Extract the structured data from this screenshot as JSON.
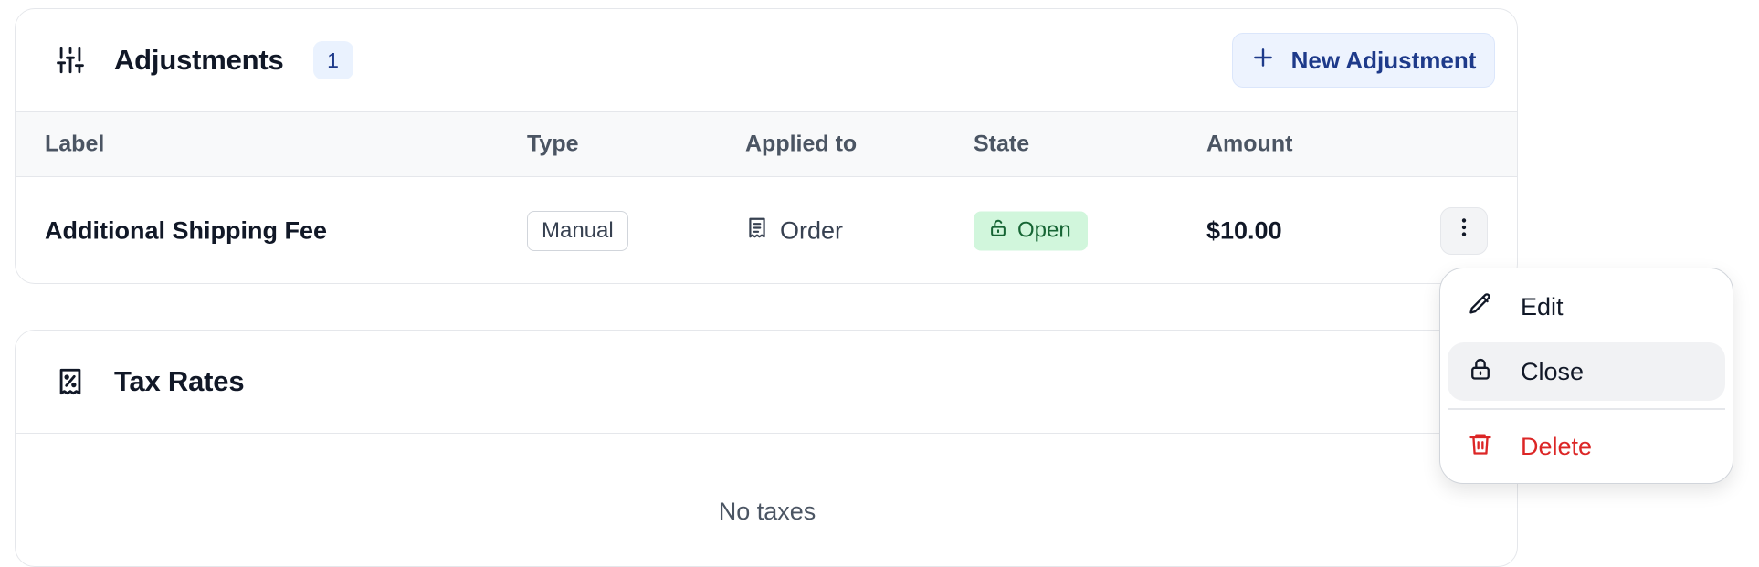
{
  "adjustments": {
    "title": "Adjustments",
    "count": "1",
    "new_button_label": "New Adjustment",
    "columns": [
      "Label",
      "Type",
      "Applied to",
      "State",
      "Amount"
    ],
    "rows": [
      {
        "label": "Additional Shipping Fee",
        "type": "Manual",
        "applied_to": "Order",
        "state": "Open",
        "amount": "$10.00"
      }
    ]
  },
  "tax_rates": {
    "title": "Tax Rates",
    "empty_text": "No taxes"
  },
  "row_menu": {
    "items": [
      {
        "label": "Edit",
        "icon": "pencil-icon"
      },
      {
        "label": "Close",
        "icon": "lock-icon"
      },
      {
        "label": "Delete",
        "icon": "trash-icon"
      }
    ]
  },
  "colors": {
    "accent": "#1e3a8a",
    "badge_bg": "#eaf2fe",
    "open_bg": "#d1f6dc",
    "open_text": "#166534",
    "danger": "#dc2626"
  }
}
